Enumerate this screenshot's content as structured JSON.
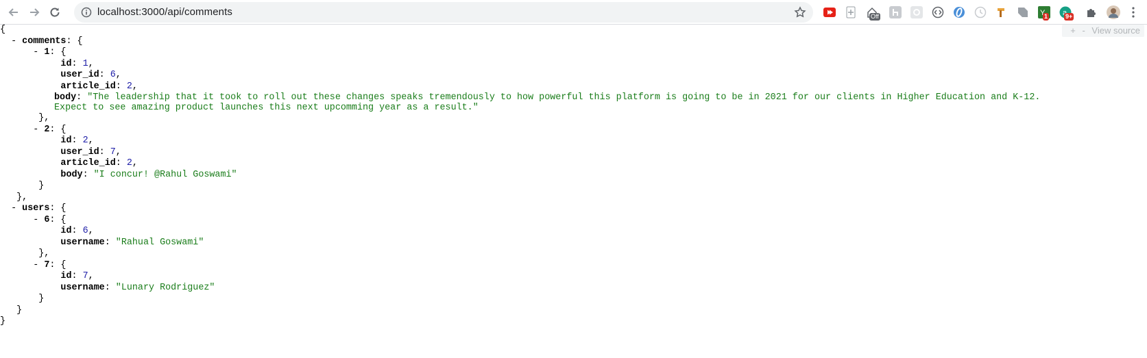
{
  "browser": {
    "url": "localhost:3000/api/comments",
    "ext_badges": {
      "off": "Off",
      "count_a": "1",
      "count_b": "9+"
    }
  },
  "viewer": {
    "plus": "+",
    "minus": "-",
    "view_source": "View source"
  },
  "json": {
    "open": "{",
    "close": "}",
    "comments_key": "comments",
    "users_key": "users",
    "c1_key": "1",
    "c1_id": "1",
    "c1_user_id": "6",
    "c1_article_id": "2",
    "c1_body": "\"The leadership that it took to roll out these changes speaks tremendously to how powerful this platform is going to be in 2021 for our clients in Higher Education and K-12. Expect to see amazing product launches this next upcomming year as a result.\"",
    "c2_key": "2",
    "c2_id": "2",
    "c2_user_id": "7",
    "c2_article_id": "2",
    "c2_body": "\"I concur! @Rahul Goswami\"",
    "u6_key": "6",
    "u6_id": "6",
    "u6_username": "\"Rahual Goswami\"",
    "u7_key": "7",
    "u7_id": "7",
    "u7_username": "\"Lunary Rodriguez\""
  },
  "colors": {
    "string": "#1a7d1a",
    "number": "#1a1aa6"
  }
}
